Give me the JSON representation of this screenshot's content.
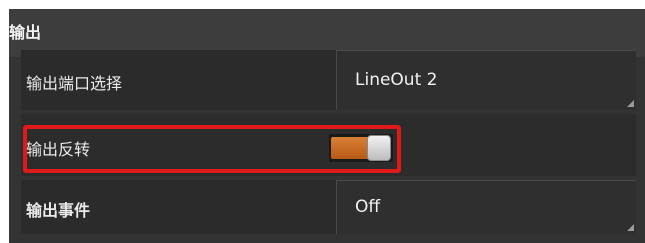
{
  "section": {
    "title": "输出"
  },
  "rows": [
    {
      "label": "输出端口选择",
      "value": "LineOut 2",
      "control": "dropdown"
    },
    {
      "label": "输出反转",
      "control": "toggle",
      "toggle_on": true,
      "highlighted": true
    },
    {
      "label": "输出事件",
      "value": "Off",
      "control": "dropdown"
    }
  ],
  "colors": {
    "panel_background": "#333333",
    "toggle_on": "#c96b22",
    "highlight_border": "#e0191b",
    "text": "#eaeaea"
  }
}
